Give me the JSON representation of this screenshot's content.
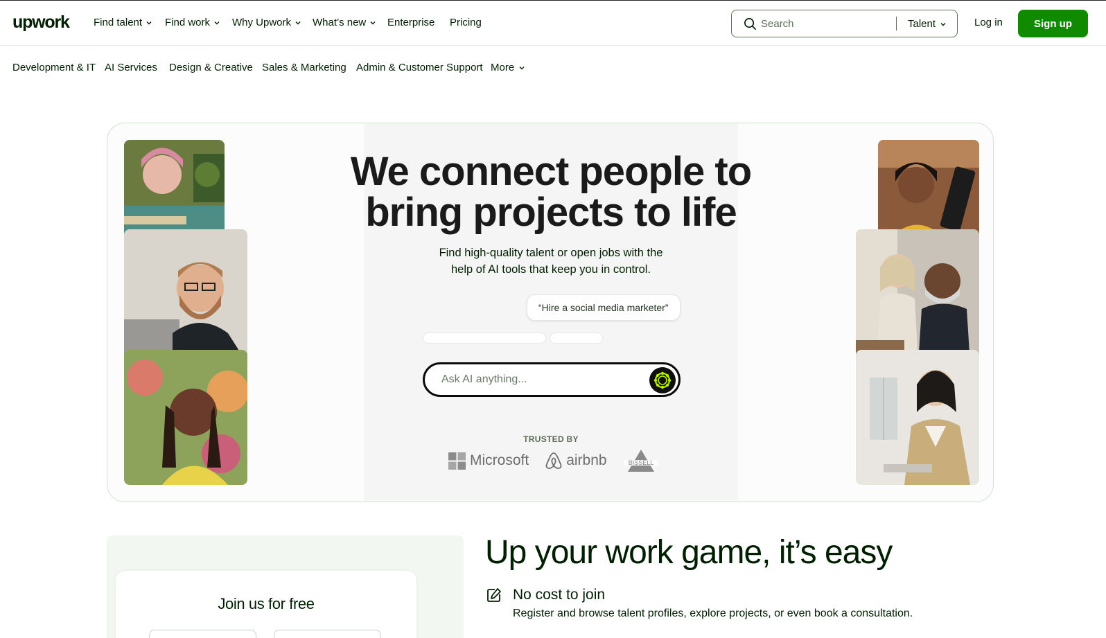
{
  "header": {
    "logo": "upwork",
    "nav": [
      {
        "label": "Find talent",
        "dropdown": true
      },
      {
        "label": "Find work",
        "dropdown": true
      },
      {
        "label": "Why Upwork",
        "dropdown": true
      },
      {
        "label": "What’s new",
        "dropdown": true
      },
      {
        "label": "Enterprise",
        "dropdown": false
      },
      {
        "label": "Pricing",
        "dropdown": false
      }
    ],
    "search": {
      "placeholder": "Search",
      "scope": "Talent"
    },
    "login": "Log in",
    "signup": "Sign up"
  },
  "categories": {
    "items": [
      "Development & IT",
      "AI Services",
      "Design & Creative",
      "Sales & Marketing",
      "Admin & Customer Support"
    ],
    "more": "More"
  },
  "hero": {
    "title_line1": "We connect people to",
    "title_line2": "bring projects to life",
    "subtitle_line1": "Find high-quality talent or open jobs with the",
    "subtitle_line2": "help of AI tools that keep you in control.",
    "suggestion": "“Hire a social media marketer”",
    "ai_placeholder": "Ask AI anything...",
    "trusted_by": "TRUSTED BY",
    "brands": [
      "Microsoft",
      "airbnb",
      "Bissell"
    ]
  },
  "lower": {
    "join_title": "Join us for free",
    "section_title": "Up your work game, it’s easy",
    "benefit_title": "No cost to join",
    "benefit_desc": "Register and browse talent profiles, explore projects, or even book a consultation."
  },
  "colors": {
    "brand_green": "#108a00",
    "text_dark": "#001e00",
    "muted": "#5e6d55",
    "ai_ring": "#b8f000"
  },
  "icons": [
    "search-icon",
    "chevron-down-icon",
    "ai-sparkle-icon",
    "edit-icon"
  ]
}
